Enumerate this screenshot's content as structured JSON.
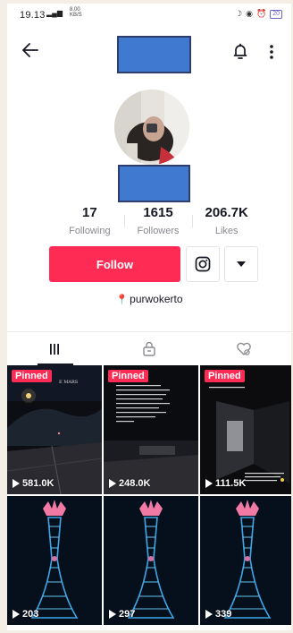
{
  "status_bar": {
    "time": "19.13",
    "net_speed_top": "8.00",
    "net_speed_bottom": "KB/S",
    "battery": "20"
  },
  "profile": {
    "location": "purwokerto",
    "stats": [
      {
        "value": "17",
        "label": "Following"
      },
      {
        "value": "1615",
        "label": "Followers"
      },
      {
        "value": "206.7K",
        "label": "Likes"
      }
    ]
  },
  "actions": {
    "follow_label": "Follow"
  },
  "videos": [
    {
      "pinned_label": "Pinned",
      "views": "581.0K"
    },
    {
      "pinned_label": "Pinned",
      "views": "248.0K"
    },
    {
      "pinned_label": "Pinned",
      "views": "111.5K"
    },
    {
      "pinned_label": "",
      "views": "203"
    },
    {
      "pinned_label": "",
      "views": "297"
    },
    {
      "pinned_label": "",
      "views": "339"
    }
  ],
  "colors": {
    "accent": "#fe2c55",
    "text": "#161823",
    "muted": "#8a8b91",
    "redaction": "#3f7ad0"
  },
  "icons": [
    "back-arrow-icon",
    "bell-icon",
    "more-vertical-icon",
    "instagram-icon",
    "caret-down-icon",
    "location-pin-icon",
    "grid-icon",
    "lock-icon",
    "liked-heart-icon",
    "play-icon"
  ]
}
